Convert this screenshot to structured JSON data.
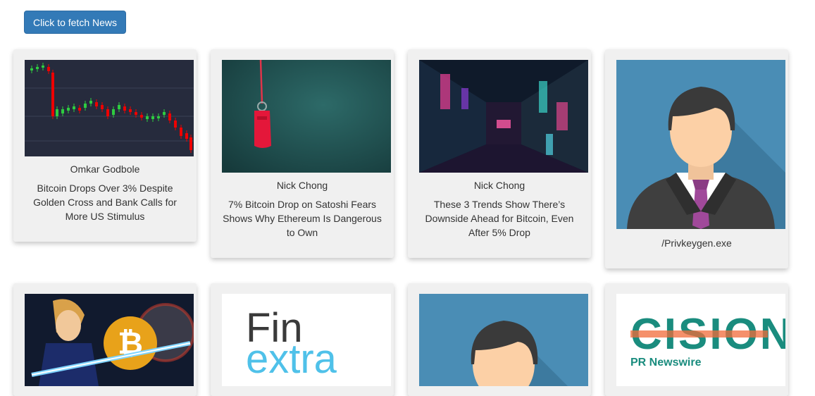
{
  "toolbar": {
    "fetch_label": "Click to fetch News"
  },
  "articles": [
    {
      "author": "Omkar Godbole",
      "title": "Bitcoin Drops Over 3% Despite Golden Cross and Bank Calls for More US Stimulus",
      "image": "candlestick-chart-image"
    },
    {
      "author": "Nick Chong",
      "title": "7% Bitcoin Drop on Satoshi Fears Shows Why Ethereum Is Dangerous to Own",
      "image": "red-whistle-image"
    },
    {
      "author": "Nick Chong",
      "title": "These 3 Trends Show There’s Downside Ahead for Bitcoin, Even After 5% Drop",
      "image": "neon-alley-image"
    },
    {
      "author": "",
      "title": "/Privkeygen.exe",
      "image": "default-avatar-image"
    },
    {
      "author": "",
      "title": "",
      "image": "lightsaber-bitcoin-image"
    },
    {
      "author": "",
      "title": "",
      "image": "finextra-logo",
      "logo_text": [
        "Fin",
        "extra"
      ]
    },
    {
      "author": "",
      "title": "",
      "image": "default-avatar-image"
    },
    {
      "author": "",
      "title": "",
      "image": "cision-logo",
      "logo_text": [
        "CISION",
        "PR Newswire"
      ]
    }
  ],
  "colors": {
    "button": "#337ab7",
    "card": "#f0f0f0",
    "avatar_bg": "#4a8db5",
    "tie": "#a0499a",
    "cision_teal": "#1a8c7e",
    "cision_orange": "#f26b3a",
    "finextra_blue": "#4fc1e9"
  }
}
